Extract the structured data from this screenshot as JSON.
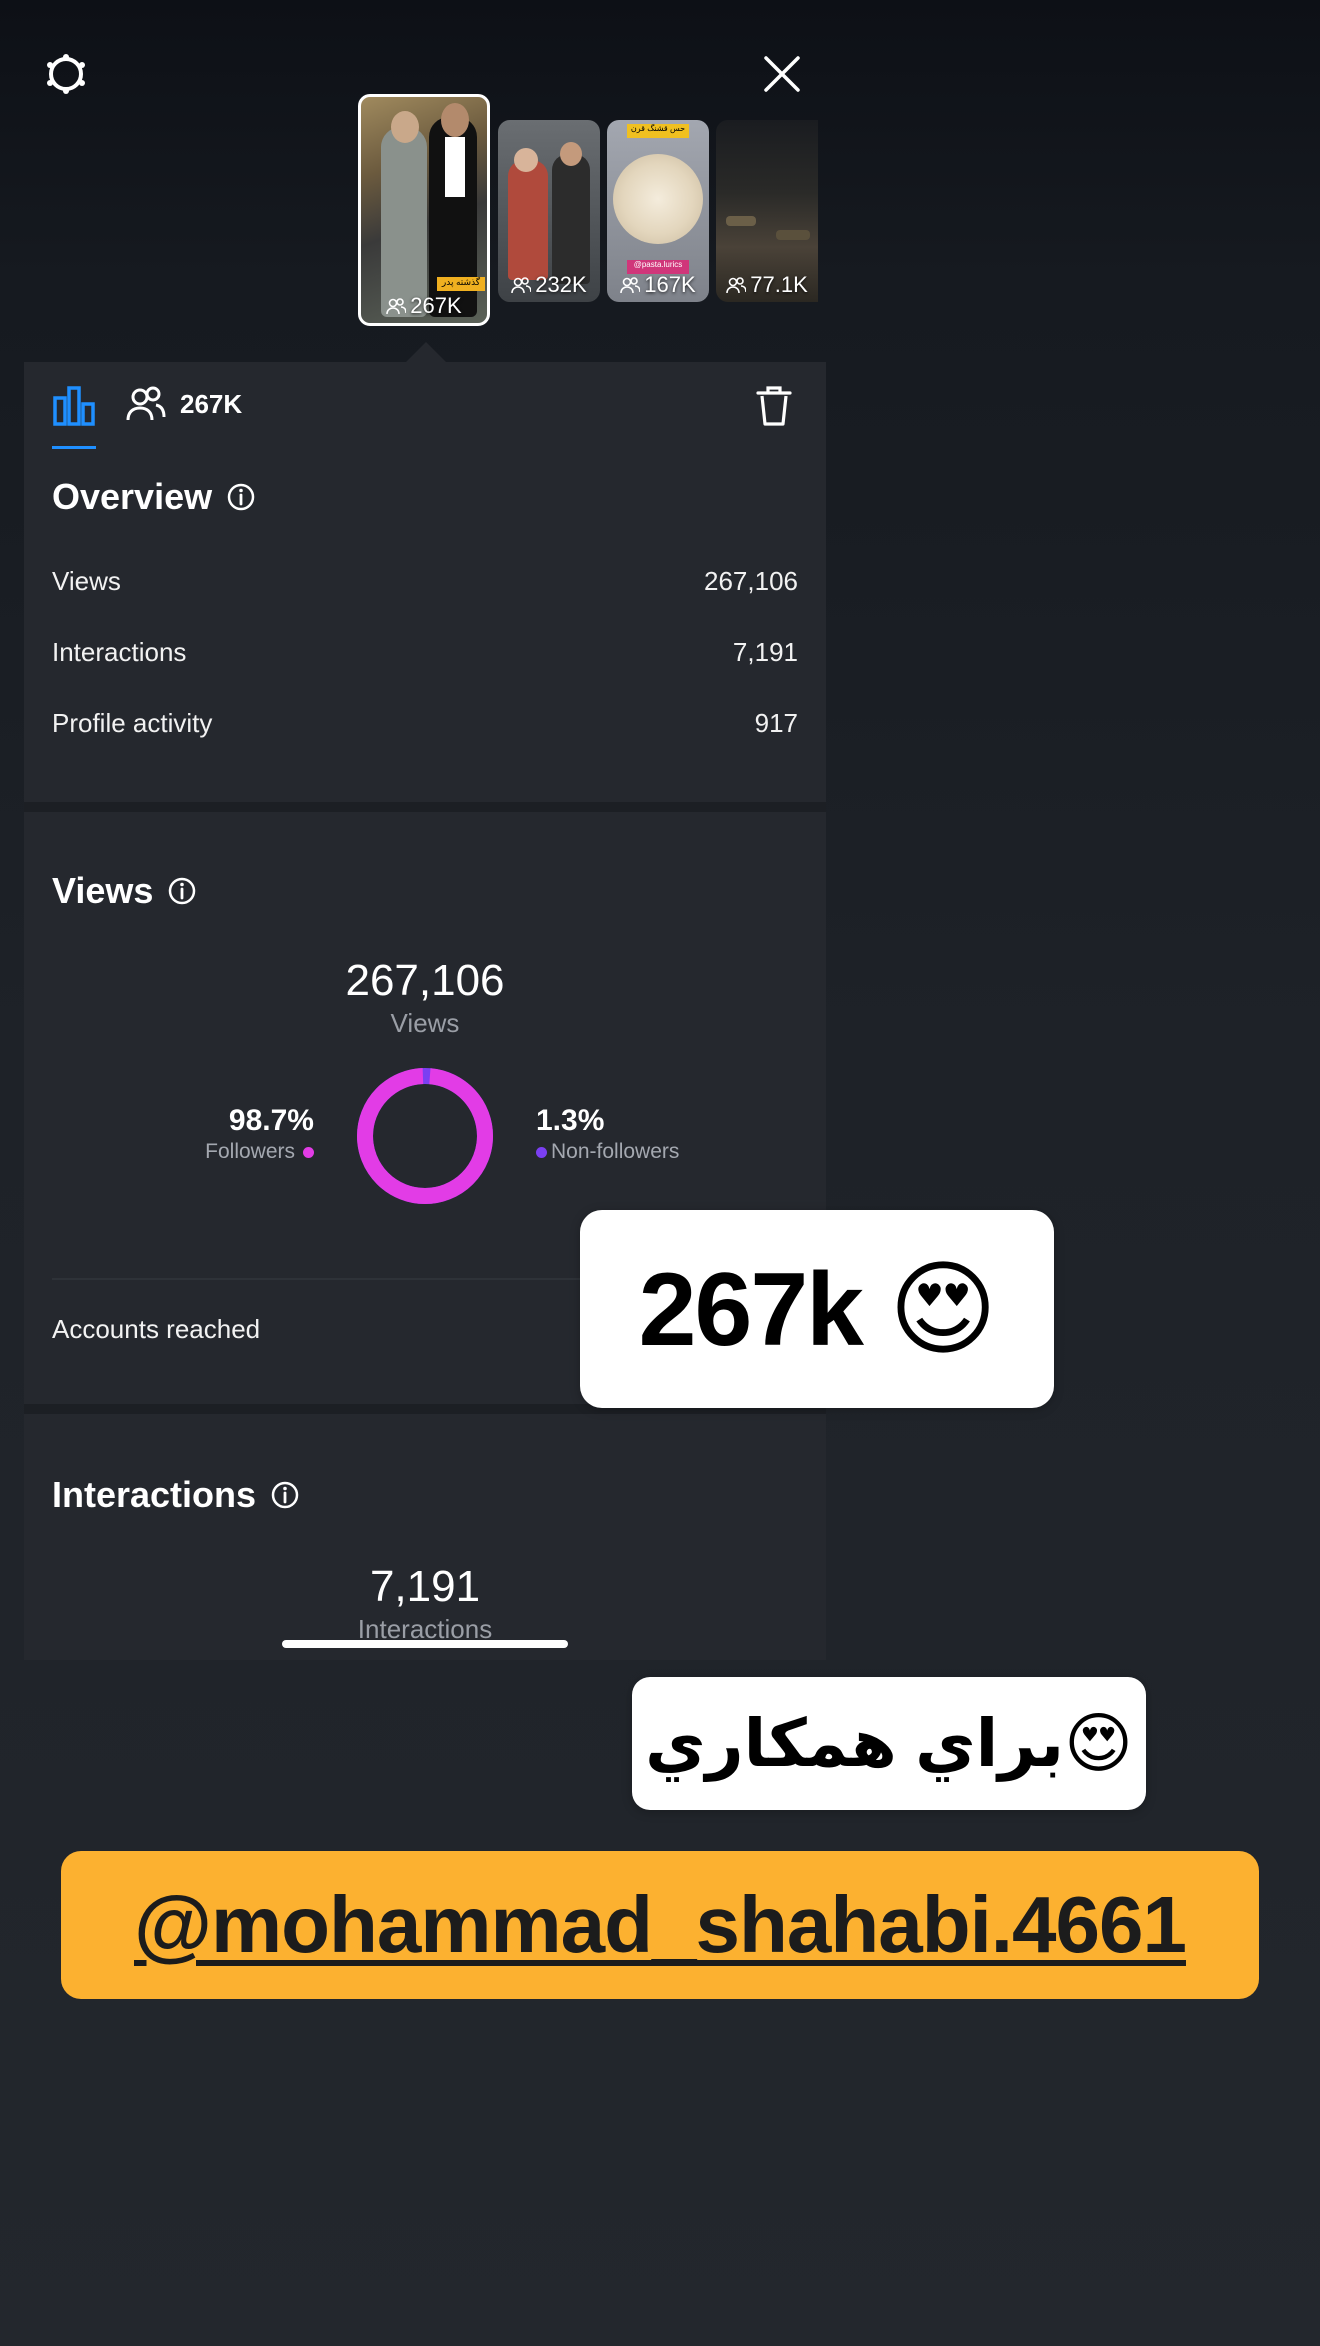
{
  "header": {
    "settings_icon": "settings-ring-icon",
    "close_icon": "close-icon"
  },
  "thumbnails": [
    {
      "count": "267K",
      "selected": true
    },
    {
      "count": "232K",
      "selected": false
    },
    {
      "count": "167K",
      "selected": false
    },
    {
      "count": "77.1K",
      "selected": false
    }
  ],
  "thumb_badges": {
    "t1_label": "گذشته پدر",
    "t3_label": "@pasta.lurics",
    "t3_top": "حس قشنگ قرن"
  },
  "tabs": {
    "stats_icon": "bar-chart-icon",
    "audience_icon": "people-icon",
    "audience_count": "267K",
    "delete_icon": "trash-icon"
  },
  "overview": {
    "title": "Overview",
    "rows": [
      {
        "label": "Views",
        "value": "267,106"
      },
      {
        "label": "Interactions",
        "value": "7,191"
      },
      {
        "label": "Profile activity",
        "value": "917"
      }
    ]
  },
  "views": {
    "title": "Views",
    "total": "267,106",
    "total_label": "Views",
    "followers_pct": "98.7%",
    "followers_label": "Followers",
    "non_followers_pct": "1.3%",
    "non_followers_label": "Non-followers",
    "followers_fraction": 0.987,
    "accounts_reached_label": "Accounts reached"
  },
  "interactions": {
    "title": "Interactions",
    "total": "7,191",
    "total_label": "Interactions"
  },
  "stickers": {
    "big": "267k 😍",
    "persian": "براي همكاري😍",
    "mention": "@mohammad_shahabi.4661"
  },
  "colors": {
    "followers": "#e23ce6",
    "non_followers": "#7b3ff2",
    "accent": "#1f8fff",
    "mention_bg": "#fcb130"
  }
}
